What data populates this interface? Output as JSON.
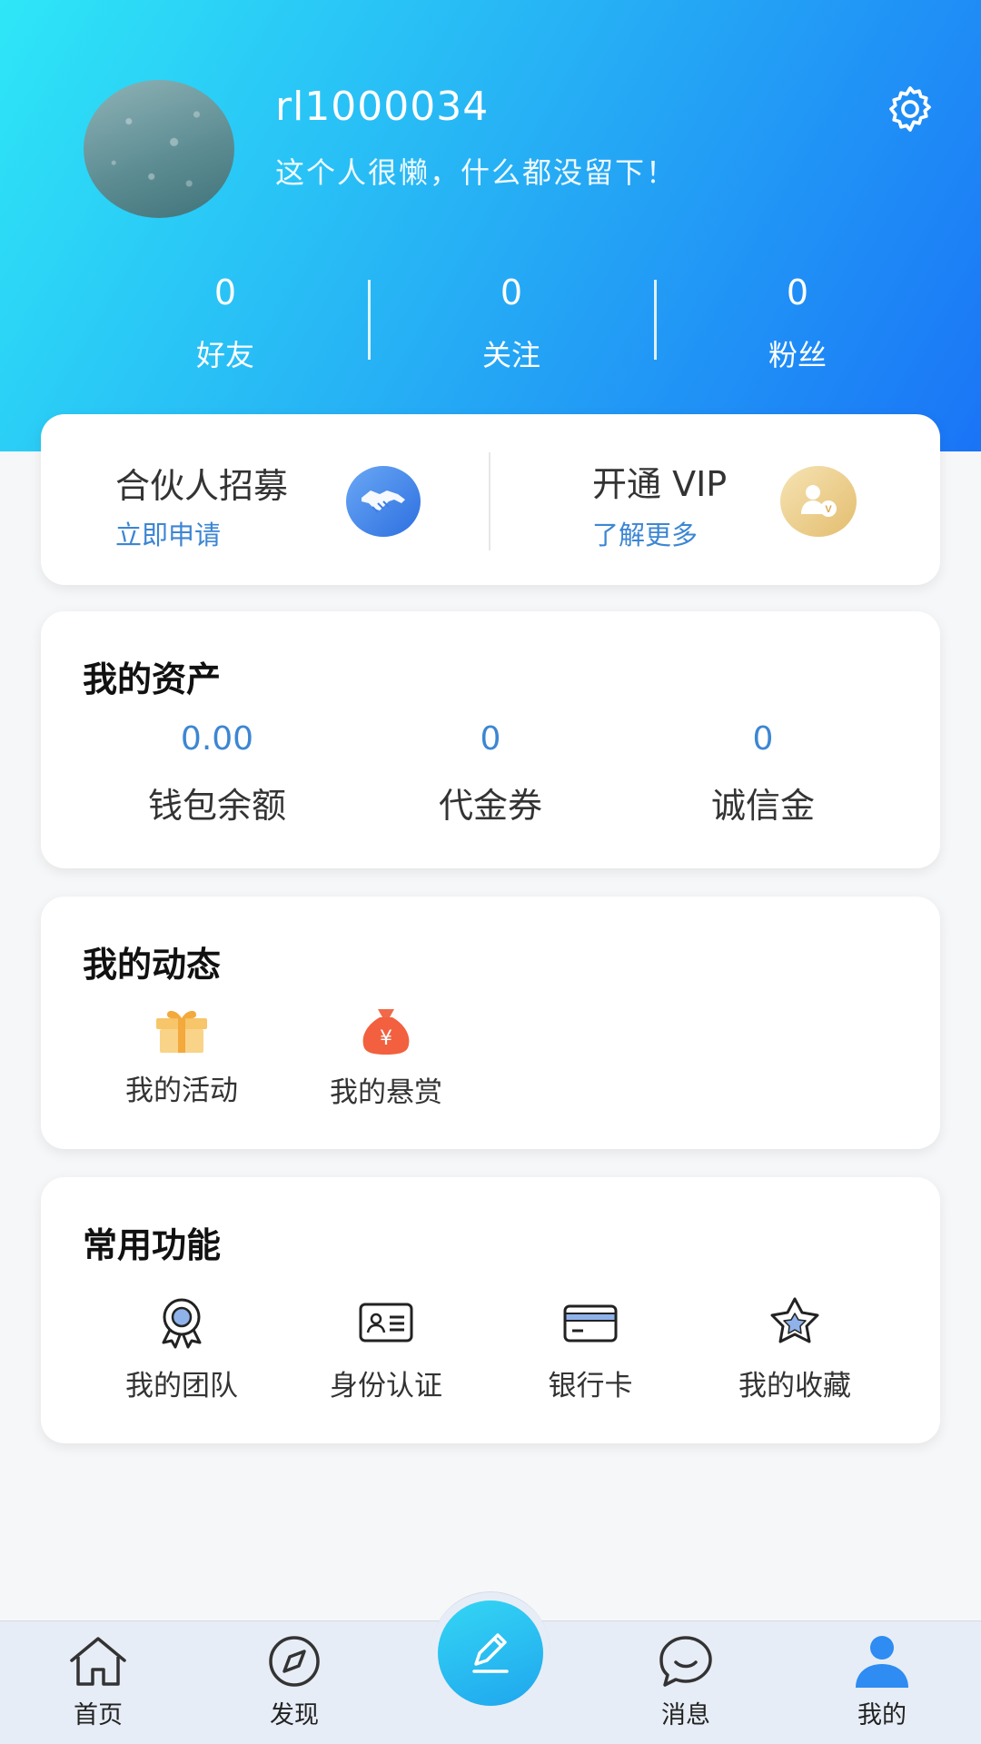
{
  "profile": {
    "username": "rl1000034",
    "bio": "这个人很懒，什么都没留下！"
  },
  "stats": [
    {
      "value": "0",
      "label": "好友"
    },
    {
      "value": "0",
      "label": "关注"
    },
    {
      "value": "0",
      "label": "粉丝"
    }
  ],
  "promo": {
    "partner": {
      "title": "合伙人招募",
      "action": "立即申请"
    },
    "vip": {
      "title": "开通 VIP",
      "action": "了解更多"
    }
  },
  "assets": {
    "title": "我的资产",
    "items": [
      {
        "value": "0.00",
        "label": "钱包余额"
      },
      {
        "value": "0",
        "label": "代金券"
      },
      {
        "value": "0",
        "label": "诚信金"
      }
    ]
  },
  "activity": {
    "title": "我的动态",
    "items": [
      {
        "label": "我的活动",
        "icon": "gift-icon"
      },
      {
        "label": "我的悬赏",
        "icon": "money-bag-icon"
      }
    ]
  },
  "functions": {
    "title": "常用功能",
    "items": [
      {
        "label": "我的团队",
        "icon": "award-badge-icon"
      },
      {
        "label": "身份认证",
        "icon": "id-card-icon"
      },
      {
        "label": "银行卡",
        "icon": "bank-card-icon"
      },
      {
        "label": "我的收藏",
        "icon": "star-icon"
      }
    ]
  },
  "tabbar": [
    {
      "label": "首页",
      "icon": "home-icon"
    },
    {
      "label": "发现",
      "icon": "compass-icon"
    },
    {
      "label": "",
      "icon": "pencil-icon"
    },
    {
      "label": "消息",
      "icon": "chat-bubble-icon"
    },
    {
      "label": "我的",
      "icon": "user-icon",
      "active": true
    }
  ],
  "colors": {
    "accent": "#3d86d3",
    "header_gradient": [
      "#2ee6f7",
      "#1a74f6"
    ]
  }
}
